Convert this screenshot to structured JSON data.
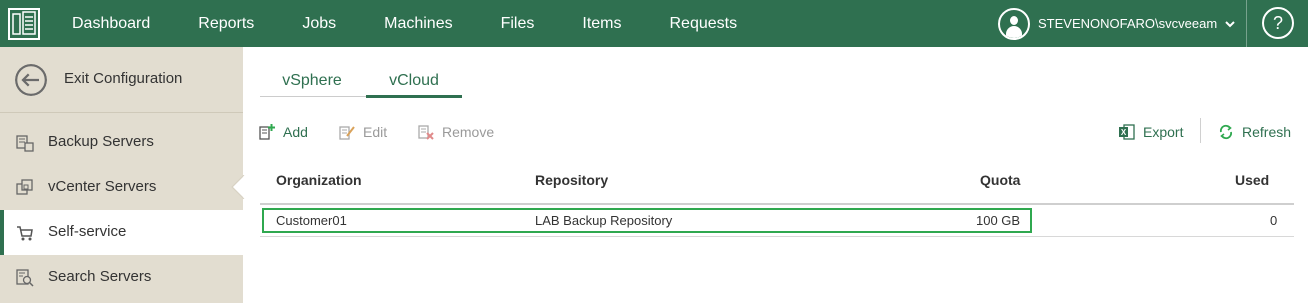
{
  "topbar": {
    "nav": [
      "Dashboard",
      "Reports",
      "Jobs",
      "Machines",
      "Files",
      "Items",
      "Requests"
    ],
    "user": "STEVENONOFARO\\svcveeam",
    "help_label": "?"
  },
  "sidebar": {
    "exit_label": "Exit Configuration",
    "items": [
      {
        "label": "Backup Servers",
        "icon": "backup-servers-icon"
      },
      {
        "label": "vCenter Servers",
        "icon": "vcenter-servers-icon"
      },
      {
        "label": "Self-service",
        "icon": "cart-icon",
        "active": true
      },
      {
        "label": "Search Servers",
        "icon": "search-servers-icon"
      }
    ]
  },
  "tabs": [
    {
      "label": "vSphere",
      "active": false
    },
    {
      "label": "vCloud",
      "active": true
    }
  ],
  "toolbar": {
    "add": "Add",
    "edit": "Edit",
    "remove": "Remove",
    "export": "Export",
    "refresh": "Refresh"
  },
  "table": {
    "columns": [
      "Organization",
      "Repository",
      "Quota",
      "Used"
    ],
    "rows": [
      {
        "organization": "Customer01",
        "repository": "LAB Backup Repository",
        "quota": "100 GB",
        "used": "0"
      }
    ]
  },
  "colors": {
    "brand": "#2f7050",
    "sidebar_bg": "#e2ddd0",
    "highlight": "#2fa84f"
  }
}
